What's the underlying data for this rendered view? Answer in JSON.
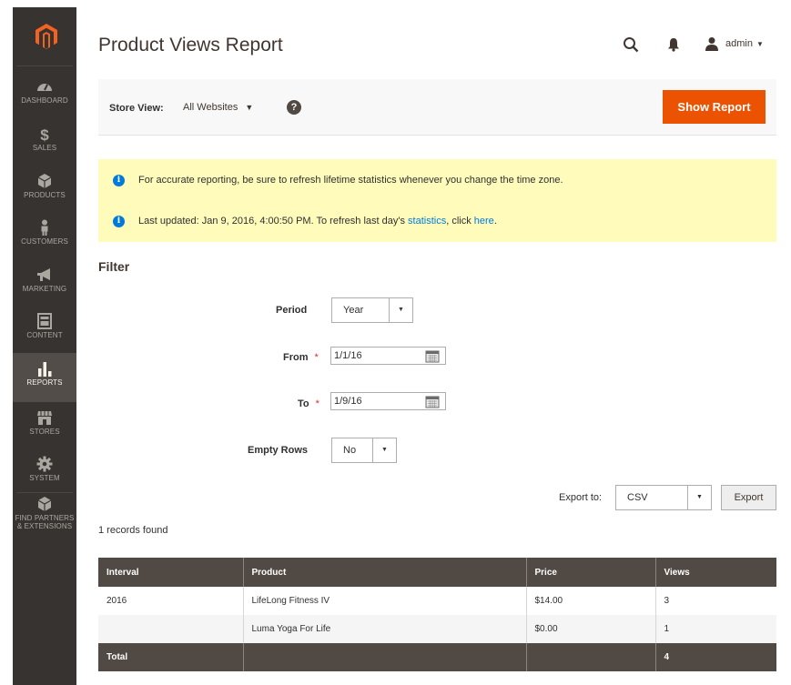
{
  "sidebar": {
    "logo": "magento-logo-icon",
    "items": [
      {
        "label": "DASHBOARD",
        "icon": "dashboard-icon"
      },
      {
        "label": "SALES",
        "icon": "dollar-icon"
      },
      {
        "label": "PRODUCTS",
        "icon": "box-icon"
      },
      {
        "label": "CUSTOMERS",
        "icon": "person-icon"
      },
      {
        "label": "MARKETING",
        "icon": "megaphone-icon"
      },
      {
        "label": "CONTENT",
        "icon": "layout-icon"
      },
      {
        "label": "REPORTS",
        "icon": "bar-chart-icon",
        "active": true
      },
      {
        "label": "STORES",
        "icon": "store-icon"
      },
      {
        "label": "SYSTEM",
        "icon": "gear-icon"
      },
      {
        "label": "FIND PARTNERS",
        "label2": "& EXTENSIONS",
        "icon": "puzzle-box-icon"
      }
    ]
  },
  "header": {
    "title": "Product Views Report",
    "user": "admin"
  },
  "store_bar": {
    "label": "Store View:",
    "value": "All Websites",
    "help": "?",
    "show_report": "Show Report"
  },
  "messages": {
    "m1": "For accurate reporting, be sure to refresh lifetime statistics whenever you change the time zone.",
    "m2_pre": "Last updated: Jan 9, 2016, 4:00:50 PM. To refresh last day's ",
    "m2_link1": "statistics",
    "m2_mid": ", click ",
    "m2_link2": "here",
    "m2_post": "."
  },
  "filter": {
    "title": "Filter",
    "period_label": "Period",
    "period_value": "Year",
    "from_label": "From",
    "from_value": "1/1/16",
    "to_label": "To",
    "to_value": "1/9/16",
    "required": "*",
    "empty_rows_label": "Empty Rows",
    "empty_rows_value": "No"
  },
  "export": {
    "label": "Export to:",
    "format": "CSV",
    "button": "Export"
  },
  "records_found": "1 records found",
  "grid": {
    "headers": [
      "Interval",
      "Product",
      "Price",
      "Views"
    ],
    "rows": [
      [
        "2016",
        "LifeLong Fitness IV",
        "$14.00",
        "3"
      ],
      [
        "",
        "Luma Yoga For Life",
        "$0.00",
        "1"
      ]
    ],
    "total": [
      "Total",
      "",
      "",
      "4"
    ]
  },
  "colors": {
    "accent": "#eb5202",
    "sidebar": "#373330",
    "grid_header": "#514943",
    "message_bg": "#fffbbb",
    "link": "#007bdb"
  }
}
